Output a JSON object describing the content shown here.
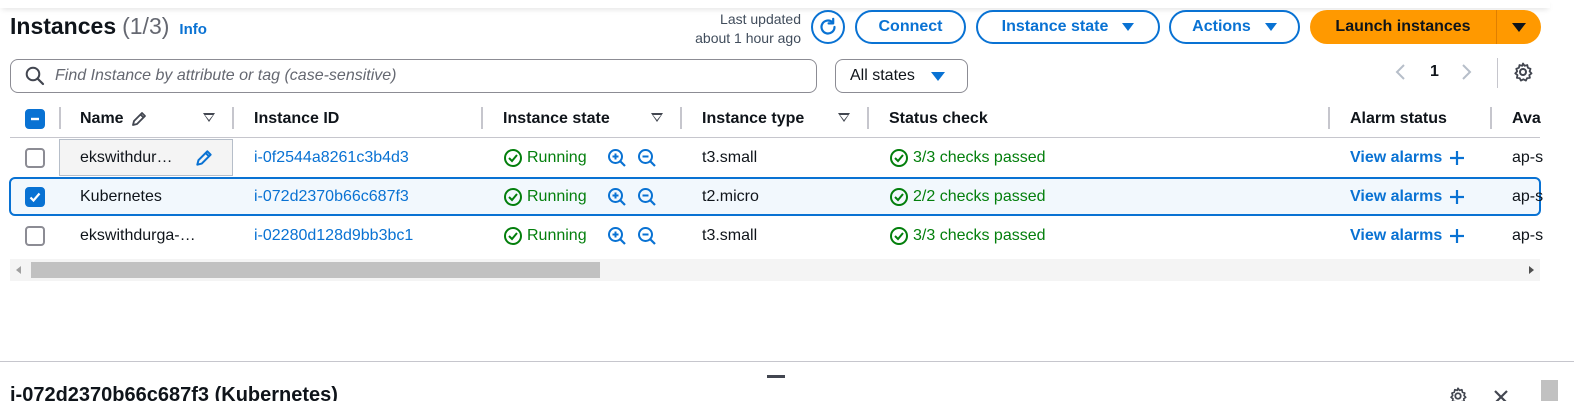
{
  "header": {
    "title": "Instances",
    "count": "(1/3)",
    "info_link": "Info",
    "last_updated_line1": "Last updated",
    "last_updated_line2": "about 1 hour ago",
    "connect_label": "Connect",
    "instance_state_label": "Instance state",
    "actions_label": "Actions",
    "launch_label": "Launch instances"
  },
  "filter": {
    "search_placeholder": "Find Instance by attribute or tag (case-sensitive)",
    "states_selected": "All states"
  },
  "pagination": {
    "current_page": "1"
  },
  "table": {
    "columns": [
      "Name",
      "Instance ID",
      "Instance state",
      "Instance type",
      "Status check",
      "Alarm status",
      "Ava"
    ],
    "rows": [
      {
        "selected": false,
        "name": "ekswithdur…",
        "instance_id": "i-0f2544a8261c3b4d3",
        "state": "Running",
        "type": "t3.small",
        "status_check": "3/3 checks passed",
        "alarm": "View alarms",
        "az": "ap-s"
      },
      {
        "selected": true,
        "name": "Kubernetes",
        "instance_id": "i-072d2370b66c687f3",
        "state": "Running",
        "type": "t2.micro",
        "status_check": "2/2 checks passed",
        "alarm": "View alarms",
        "az": "ap-s"
      },
      {
        "selected": false,
        "name": "ekswithdurga-…",
        "instance_id": "i-02280d128d9bb3bc1",
        "state": "Running",
        "type": "t3.small",
        "status_check": "3/3 checks passed",
        "alarm": "View alarms",
        "az": "ap-s"
      }
    ]
  },
  "detail": {
    "title": "i-072d2370b66c687f3 (Kubernetes)"
  },
  "colors": {
    "accent": "#0972d3",
    "launch": "#ff9900",
    "success": "#037f0c"
  }
}
